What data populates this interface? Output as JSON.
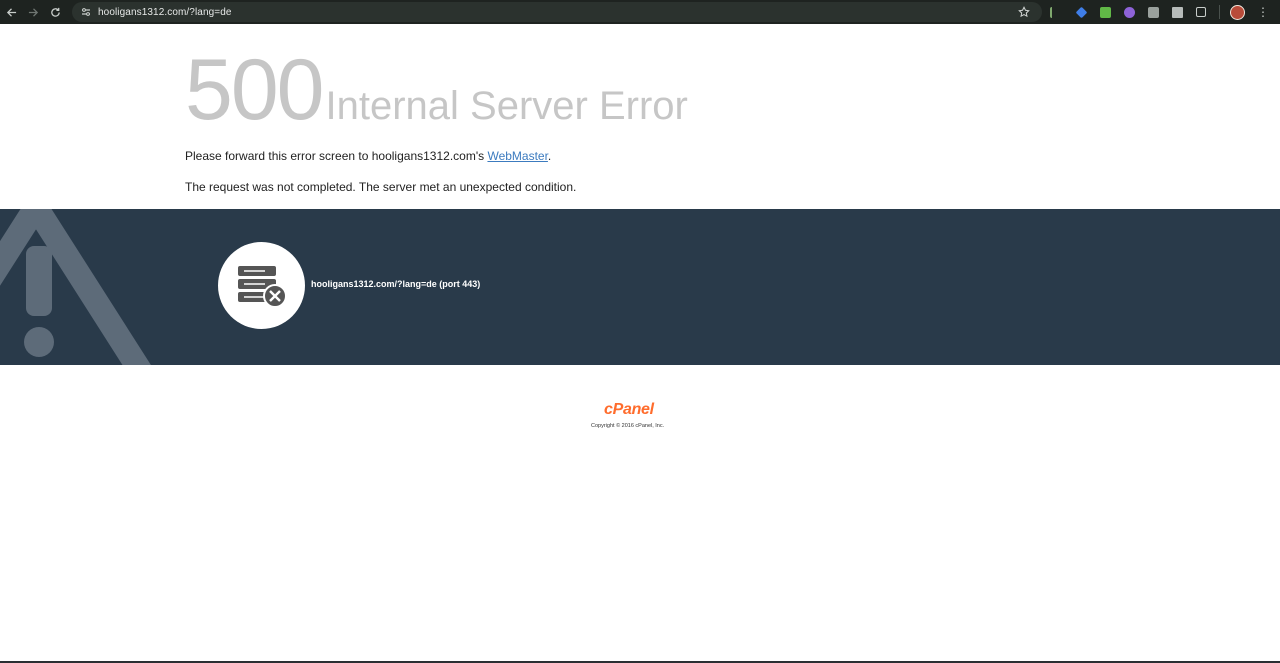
{
  "browser": {
    "url": "hooligans1312.com/?lang=de",
    "colors": {
      "toolbar": "#1e2320",
      "omnibox": "#2b322e"
    }
  },
  "error": {
    "code": "500",
    "title": "Internal Server Error",
    "message_prefix": "Please forward this error screen to hooligans1312.com's ",
    "webmaster_link": "WebMaster",
    "message_suffix": ".",
    "detail": "The request was not completed. The server met an unexpected condition."
  },
  "banner": {
    "host": "hooligans1312.com/?lang=de (port 443)",
    "colors": {
      "background": "#293a4a",
      "warning_shape": "#5d6b79"
    }
  },
  "footer": {
    "brand": "cPanel",
    "copyright": "Copyright © 2016 cPanel, Inc.",
    "colors": {
      "brand": "#ff6c2c"
    }
  }
}
